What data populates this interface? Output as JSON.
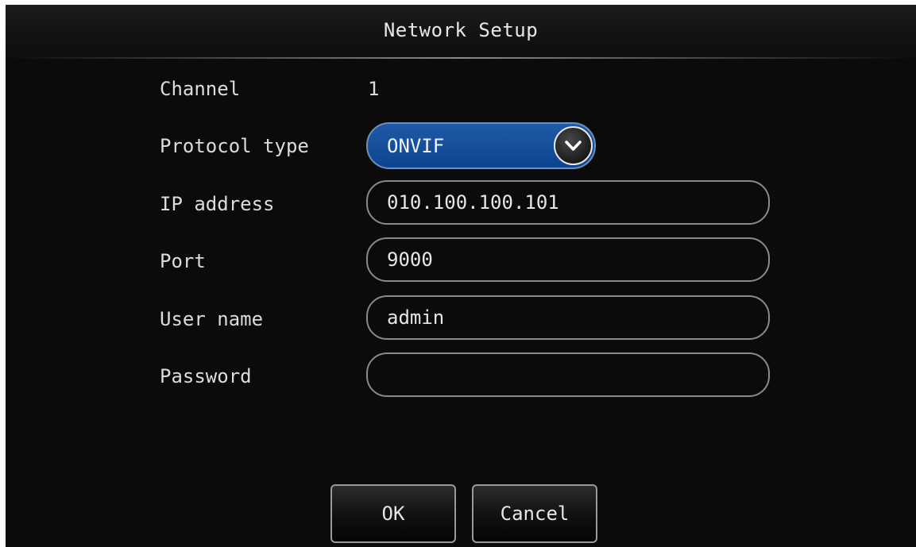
{
  "title": "Network Setup",
  "fields": {
    "channel": {
      "label": "Channel",
      "value": "1"
    },
    "protocol_type": {
      "label": "Protocol type",
      "value": "ONVIF"
    },
    "ip_address": {
      "label": "IP address",
      "value": "010.100.100.101"
    },
    "port": {
      "label": "Port",
      "value": "9000"
    },
    "user_name": {
      "label": "User name",
      "value": "admin"
    },
    "password": {
      "label": "Password",
      "value": ""
    }
  },
  "buttons": {
    "ok": "OK",
    "cancel": "Cancel"
  },
  "icons": {
    "dropdown": "chevron-down-icon"
  },
  "colors": {
    "background": "#0b0b0b",
    "select_blue": "#1f5aa6",
    "field_border": "#8a8a8a",
    "text": "#e4e4e4"
  }
}
